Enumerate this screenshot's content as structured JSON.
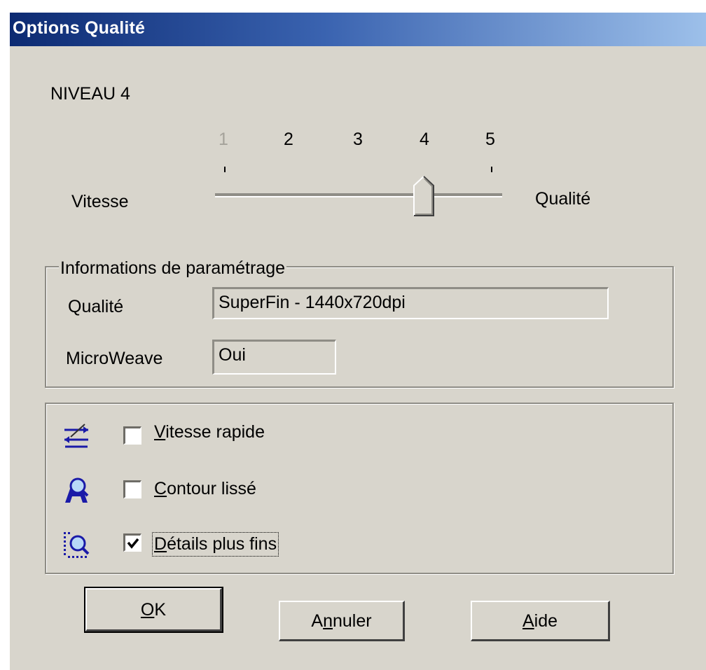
{
  "window": {
    "title": "Options Qualité"
  },
  "level": {
    "label": "NIVEAU 4"
  },
  "slider": {
    "ticks": [
      "1",
      "2",
      "3",
      "4",
      "5"
    ],
    "value": 4,
    "min_label": "Vitesse",
    "max_label": "Qualité"
  },
  "settings_info": {
    "legend": "Informations de paramétrage",
    "quality_label": "Qualité",
    "quality_value": "SuperFin - 1440x720dpi",
    "microweave_label": "MicroWeave",
    "microweave_value": "Oui"
  },
  "options": [
    {
      "mnemonic": "V",
      "rest": "itesse rapide",
      "checked": false,
      "icon": "high-speed-icon"
    },
    {
      "mnemonic": "C",
      "rest": "ontour lissé",
      "checked": false,
      "icon": "edge-smoothing-icon"
    },
    {
      "mnemonic": "D",
      "rest": "étails plus fins",
      "checked": true,
      "icon": "finer-detail-icon"
    }
  ],
  "buttons": {
    "ok": {
      "mnemonic": "O",
      "rest": "K"
    },
    "cancel": {
      "pre": "A",
      "mnemonic": "n",
      "rest": "nuler"
    },
    "help": {
      "mnemonic": "A",
      "rest": "ide"
    }
  }
}
